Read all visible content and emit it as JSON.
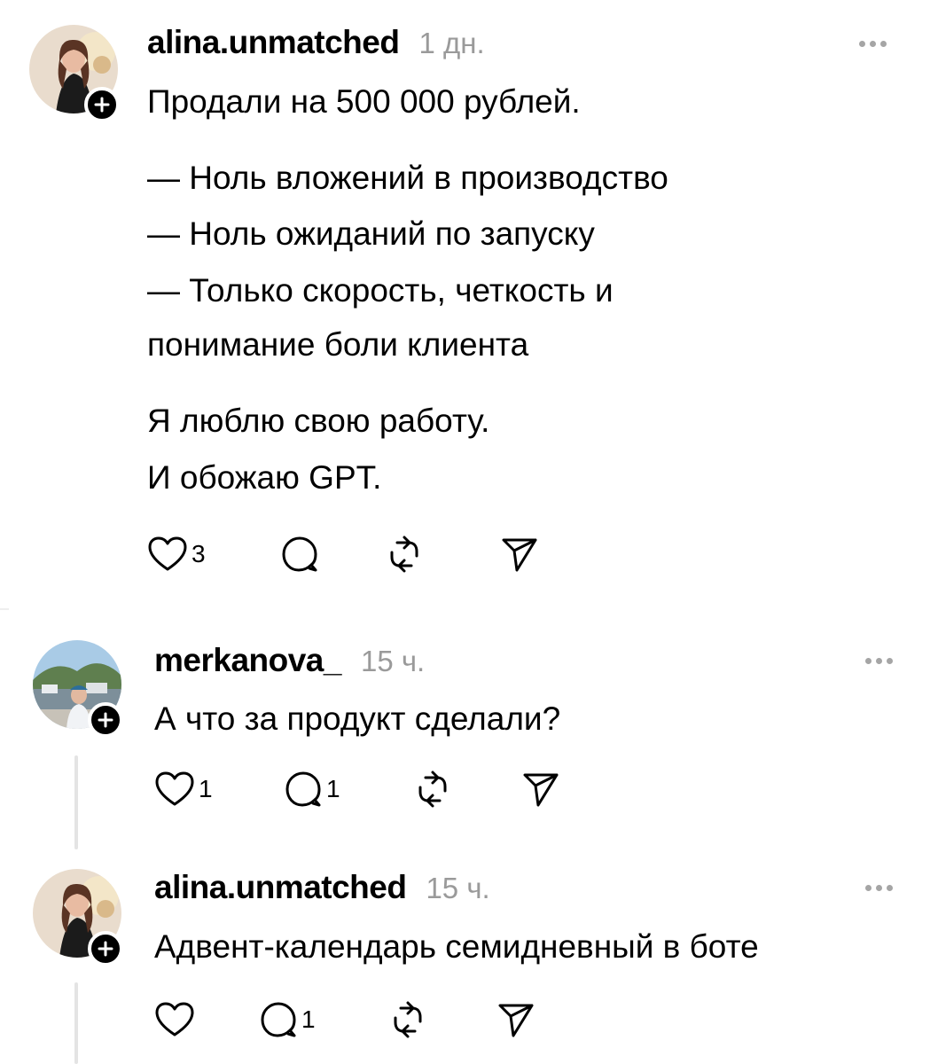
{
  "posts": [
    {
      "username": "alina.unmatched",
      "time": "1 дн.",
      "lines": [
        "Продали на 500 000 рублей.",
        "— Ноль вложений в производство",
        "— Ноль ожиданий по запуску",
        "— Только скорость, четкость и",
        "понимание боли клиента",
        "Я люблю свою работу.",
        "И обожаю GPT."
      ],
      "likes": "3",
      "replies": "",
      "avatar_icon": "avatar-photo",
      "more_icon": "more-icon"
    },
    {
      "username": "merkanova_",
      "time": "15 ч.",
      "lines": [
        "А что за продукт сделали?"
      ],
      "likes": "1",
      "replies": "1",
      "avatar_icon": "avatar-photo"
    },
    {
      "username": "alina.unmatched",
      "time": "15 ч.",
      "lines": [
        "Адвент-календарь семидневный в боте"
      ],
      "likes": "",
      "replies": "1",
      "avatar_icon": "avatar-photo"
    }
  ],
  "icons": {
    "like": "heart-icon",
    "reply": "comment-icon",
    "repost": "repost-icon",
    "share": "send-icon",
    "follow": "plus-icon"
  },
  "colors": {
    "text": "#000000",
    "muted": "#9a9a9a",
    "dots": "#a5a5a5",
    "thread_line": "#e4e4e4"
  }
}
